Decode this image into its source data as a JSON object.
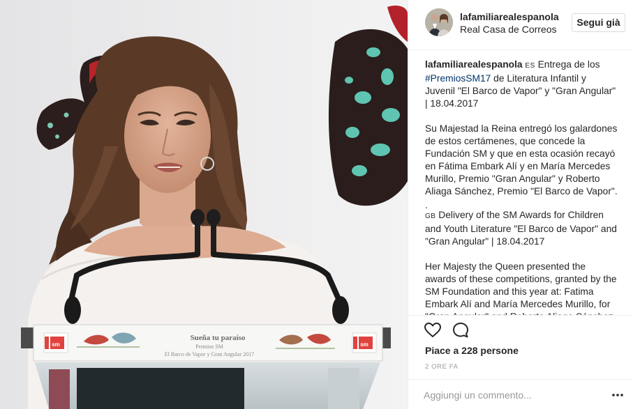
{
  "post": {
    "username": "lafamiliarealespanola",
    "location": "Real Casa de Correos",
    "follow_label": "Segui già",
    "photo": {
      "banner_title": "Sueña tu paraíso",
      "banner_line1": "Premios SM",
      "banner_line2": "El Barco de Vapor y Gran Angular 2017",
      "logo_text": "sm"
    },
    "caption": {
      "username": "lafamiliarealespanola",
      "flag_es": "ES",
      "p1_before": " Entrega de los ",
      "hashtag": "#PremiosSM17",
      "p1_after": " de Literatura Infantil y Juvenil \"El Barco de Vapor\" y \"Gran Angular\" | 18.04.2017",
      "p2": "Su Majestad la Reina entregó los galardones de estos certámenes, que concede la Fundación SM y que en esta ocasión recayó en Fátima Embark Alí y en María Mercedes Murillo, Premio \"Gran Angular\" y Roberto Aliaga Sánchez, Premio \"El Barco de Vapor\".",
      "dot": ".",
      "flag_gb": "GB",
      "p3": " Delivery of the SM Awards for Children and Youth Literature \"El Barco de Vapor\" and \"Gran Angular\" | 18.04.2017",
      "p4": "Her Majesty the Queen presented the awards of these competitions, granted by the SM Foundation and this year at: Fatima Embark Alí and María Mercedes Murillo, for \"Gran Angular\" and Roberto Aliaga Sánchez, for \"El Barco de Vapor\"."
    },
    "likes_text": "Piace a 228 persone",
    "timestamp": "2 ORE FA",
    "comment_placeholder": "Aggiungi un commento..."
  },
  "icons": {
    "like": "heart-icon",
    "comment": "comment-bubble-icon",
    "more": "more-options-icon"
  },
  "colors": {
    "hashtag": "#003569",
    "text": "#262626",
    "muted": "#999999",
    "border": "#efefef"
  }
}
